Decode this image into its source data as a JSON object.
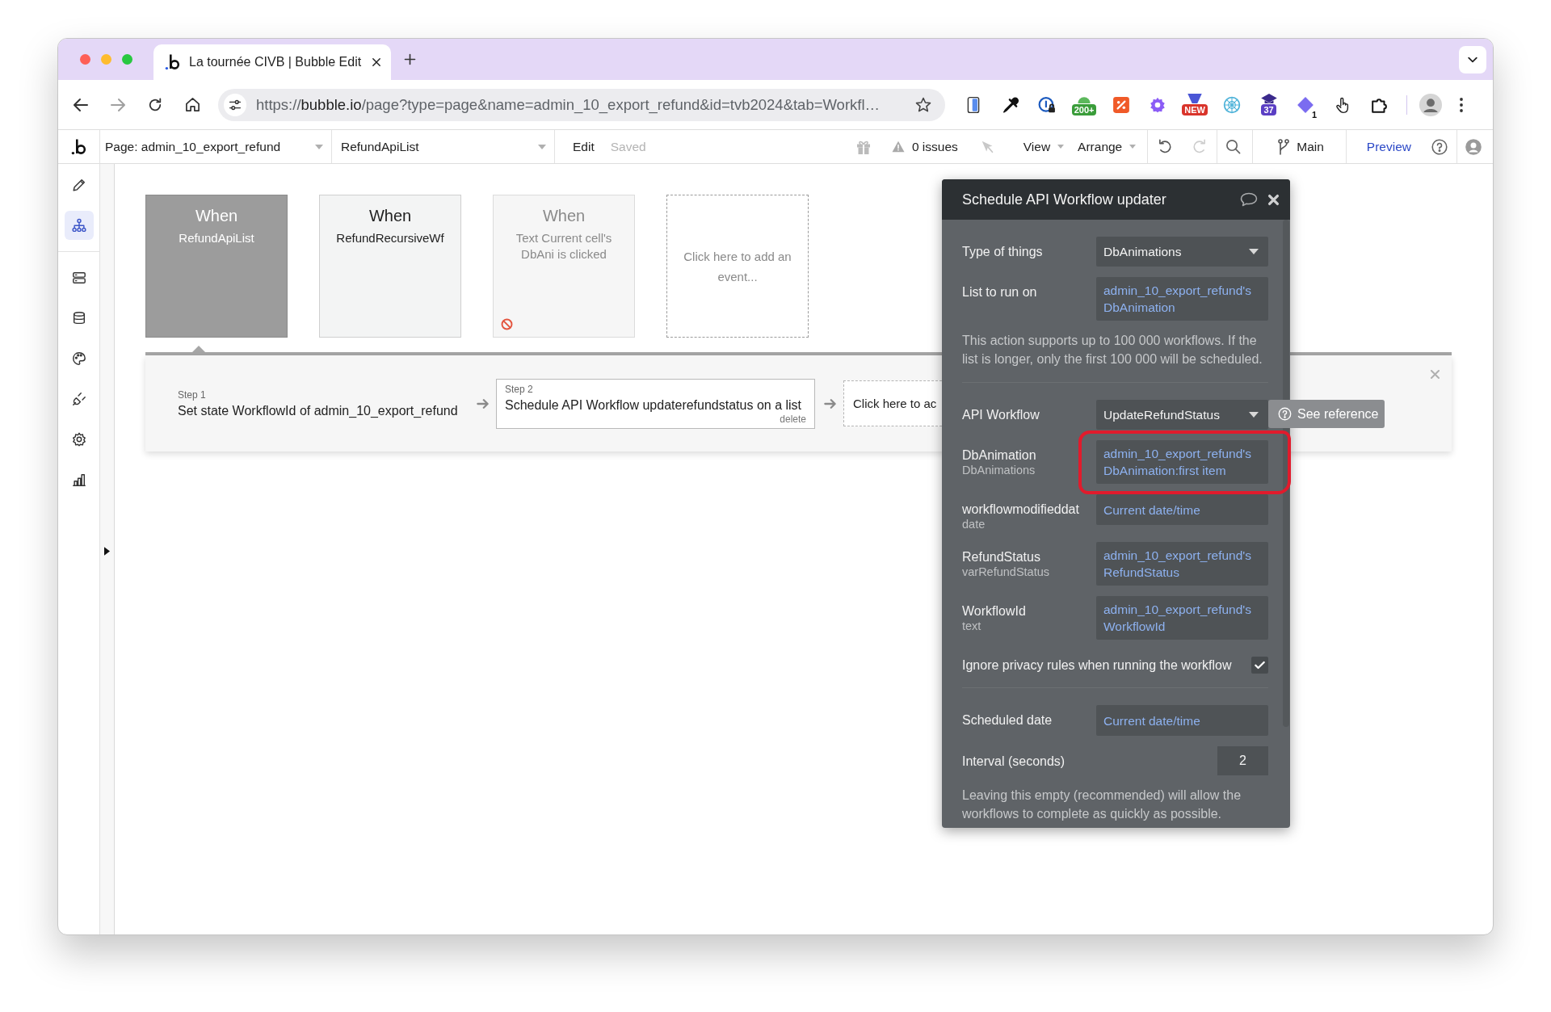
{
  "browser": {
    "tab_title": "La tournée CIVB | Bubble Edit",
    "url": "https://**bubble.io**/page?type=page&name=admin_10_export_refund&id=tvb2024&tab=Workfl…",
    "extensions": [
      {
        "kind": "device"
      },
      {
        "kind": "dropper"
      },
      {
        "kind": "password"
      },
      {
        "kind": "counter",
        "badge": "200+"
      },
      {
        "kind": "percent"
      },
      {
        "kind": "gear"
      },
      {
        "kind": "new",
        "badge": "NEW"
      },
      {
        "kind": "web"
      },
      {
        "kind": "cap",
        "badge": "37"
      },
      {
        "kind": "diamond",
        "badge": "1"
      },
      {
        "kind": "hand"
      },
      {
        "kind": "puzzle"
      }
    ]
  },
  "toolbar": {
    "page": "Page: admin_10_export_refund",
    "workflow": "RefundApiList",
    "menu": "Edit",
    "save_status": "Saved",
    "issues": "0 issues",
    "view": "View",
    "arrange": "Arrange",
    "history": [
      {
        "kind": "undo",
        "disabled": false
      },
      {
        "kind": "redo",
        "disabled": true
      }
    ],
    "branch": "Main",
    "preview": "Preview"
  },
  "sidebar": {
    "items": [
      {
        "kind": "pencil",
        "selected": false
      },
      {
        "kind": "hierarchy",
        "selected": true
      },
      {
        "kind": "server",
        "selected": false
      },
      {
        "kind": "database",
        "selected": false
      },
      {
        "kind": "palette",
        "selected": false
      },
      {
        "kind": "plug",
        "selected": false
      },
      {
        "kind": "gear",
        "selected": false
      },
      {
        "kind": "chart",
        "selected": false
      }
    ]
  },
  "events": [
    {
      "kind": "event",
      "heading": "When",
      "name": "RefundApiList",
      "selected": true,
      "disabled": false
    },
    {
      "kind": "event",
      "heading": "When",
      "name": "RefundRecursiveWf",
      "selected": false,
      "disabled": false
    },
    {
      "kind": "event",
      "heading": "When",
      "name": "Text Current cell's DbAni is clicked",
      "selected": false,
      "disabled": true
    },
    {
      "kind": "add",
      "name": "Click here to add an event...",
      "selected": false
    }
  ],
  "actions": {
    "steps": [
      {
        "kind": "step",
        "label": "Step 1",
        "text": "Set state WorkflowId of admin_10_export_refund",
        "selected": false
      },
      {
        "kind": "step",
        "label": "Step 2",
        "text": "Schedule API Workflow updaterefundstatus on a list",
        "delete_link": "delete",
        "selected": true
      },
      {
        "kind": "add",
        "text": "Click here to ac",
        "selected": false
      }
    ]
  },
  "panel": {
    "title": "Schedule API Workflow updater",
    "sections": [
      {
        "rows": [
          {
            "kind": "dropdown",
            "label": "Type of things",
            "value": "DbAnimations",
            "highlighted": false
          },
          {
            "kind": "expression",
            "label": "List to run on",
            "value": "admin_10_export_refund's DbAnimation",
            "highlighted": false
          },
          {
            "kind": "note",
            "text": "This action supports up to 100 000 workflows. If the list is longer, only the first 100 000 will be scheduled.",
            "highlighted": false
          }
        ]
      },
      {
        "rows": [
          {
            "kind": "dropdown",
            "label": "API Workflow",
            "value": "UpdateRefundStatus",
            "button": "See reference",
            "highlighted": false
          },
          {
            "kind": "expression",
            "label": "DbAnimation",
            "type": "DbAnimations",
            "value": "admin_10_export_refund's DbAnimation:first item",
            "highlighted": true
          },
          {
            "kind": "expression",
            "label": "workflowmodifieddat",
            "type": "date",
            "value": "Current date/time",
            "highlighted": false
          },
          {
            "kind": "expression",
            "label": "RefundStatus",
            "type": "varRefundStatus",
            "value": "admin_10_export_refund's RefundStatus",
            "highlighted": false
          },
          {
            "kind": "expression",
            "label": "WorkflowId",
            "type": "text",
            "value": "admin_10_export_refund's WorkflowId",
            "highlighted": false
          },
          {
            "kind": "checkbox",
            "label": "Ignore privacy rules when running the workflow",
            "checked": true,
            "highlighted": false
          }
        ]
      },
      {
        "rows": [
          {
            "kind": "expression",
            "label": "Scheduled date",
            "value": "Current date/time",
            "highlighted": false
          },
          {
            "kind": "number",
            "label": "Interval (seconds)",
            "value": "2",
            "highlighted": false
          },
          {
            "kind": "note",
            "text": "Leaving this empty (recommended) will allow the workflows to complete as quickly as possible.",
            "highlighted": false
          }
        ]
      }
    ]
  }
}
